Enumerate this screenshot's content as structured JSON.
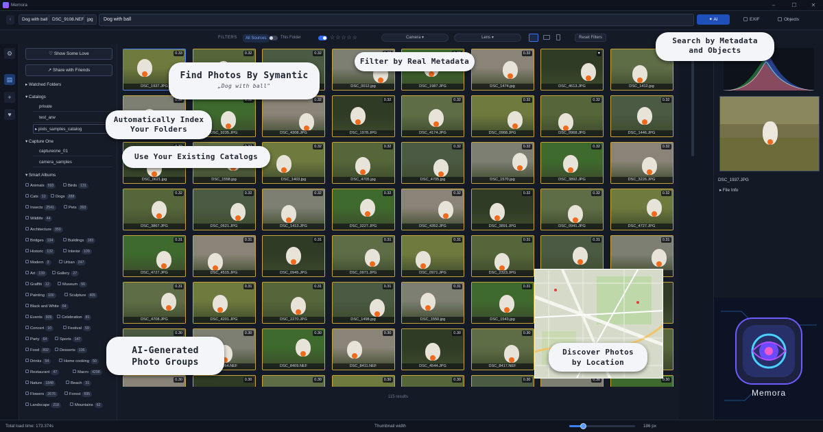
{
  "app": {
    "title": "Memora",
    "logo_text": "Memora"
  },
  "search": {
    "chips": [
      "Dog with ball",
      "DSC_9108.NEF",
      "jpg"
    ],
    "query": "Dog with ball",
    "modes": {
      "ai": "AI",
      "exif": "EXIF",
      "objects": "Objects"
    }
  },
  "filters": {
    "label": "FILTERS",
    "all_sources": "All Sources",
    "this_folder": "This Folder",
    "camera": "Camera",
    "lens": "Lens",
    "reset": "Reset Filters",
    "stars": "☆☆☆☆☆"
  },
  "sidebar": {
    "show_love": "Show Some Love",
    "share": "Share with Friends",
    "watched_folders": "Watched Folders",
    "catalogs_title": "Catalogs",
    "catalogs": [
      "private",
      "test_arw",
      "pixls_samples_catalog"
    ],
    "capture_one_title": "Capture One",
    "capture_one": [
      "captureone_01",
      "camera_samples"
    ],
    "smart_albums_title": "Smart Albums",
    "albums": [
      [
        {
          "name": "Animals",
          "count": "593"
        },
        {
          "name": "Birds",
          "count": "131"
        }
      ],
      [
        {
          "name": "Cats",
          "count": "12"
        },
        {
          "name": "Dogs",
          "count": "288"
        }
      ],
      [
        {
          "name": "Insects",
          "count": "2541"
        },
        {
          "name": "Pets",
          "count": "393"
        }
      ],
      [
        {
          "name": "Wildlife",
          "count": "44"
        }
      ],
      [
        {
          "name": "Architecture",
          "count": "350"
        }
      ],
      [
        {
          "name": "Bridges",
          "count": "134"
        },
        {
          "name": "Buildings",
          "count": "183"
        }
      ],
      [
        {
          "name": "Historic",
          "count": "132"
        },
        {
          "name": "Interior",
          "count": "109"
        }
      ],
      [
        {
          "name": "Modern",
          "count": "3"
        },
        {
          "name": "Urban",
          "count": "247"
        }
      ],
      [
        {
          "name": "Art",
          "count": "139"
        },
        {
          "name": "Gallery",
          "count": "27"
        }
      ],
      [
        {
          "name": "Graffiti",
          "count": "12"
        },
        {
          "name": "Museum",
          "count": "56"
        }
      ],
      [
        {
          "name": "Painting",
          "count": "100"
        },
        {
          "name": "Sculpture",
          "count": "405"
        }
      ],
      [
        {
          "name": "Black and White",
          "count": "64"
        }
      ],
      [
        {
          "name": "Events",
          "count": "609"
        },
        {
          "name": "Celebration",
          "count": "81"
        }
      ],
      [
        {
          "name": "Concert",
          "count": "10"
        },
        {
          "name": "Festival",
          "count": "59"
        }
      ],
      [
        {
          "name": "Party",
          "count": "64"
        },
        {
          "name": "Sports",
          "count": "147"
        }
      ],
      [
        {
          "name": "Food",
          "count": "892"
        },
        {
          "name": "Desserts",
          "count": "136"
        }
      ],
      [
        {
          "name": "Drinks",
          "count": "54"
        },
        {
          "name": "Home cooking",
          "count": "50"
        }
      ],
      [
        {
          "name": "Restaurant",
          "count": "47"
        },
        {
          "name": "Macro",
          "count": "4298"
        }
      ],
      [
        {
          "name": "Nature",
          "count": "1848"
        },
        {
          "name": "Beach",
          "count": "31"
        }
      ],
      [
        {
          "name": "Flowers",
          "count": "2676"
        },
        {
          "name": "Forest",
          "count": "695"
        }
      ],
      [
        {
          "name": "Landscape",
          "count": "218"
        },
        {
          "name": "Mountains",
          "count": "62"
        }
      ]
    ]
  },
  "grid": {
    "rows": [
      [
        {
          "f": "DSC_1937.JPG",
          "s": "0.33"
        },
        {
          "f": "DSC_1937.JPG",
          "s": "0.32"
        },
        {
          "f": "DSC_6979.JPG",
          "s": "0.32"
        },
        {
          "f": "DSC_0012.jpg",
          "s": "0.32"
        },
        {
          "f": "DSC_1987.JPG",
          "s": "0.32"
        },
        {
          "f": "DSC_1474.jpg",
          "s": "0.32"
        },
        {
          "f": "DSC_4613.JPG",
          "s": "♥"
        },
        {
          "f": "DSC_1412.jpg",
          "s": "0.32"
        }
      ],
      [
        {
          "f": "DSC_1937.JPG",
          "s": "0.32"
        },
        {
          "f": "DSC_9235.JPG",
          "s": "0.32"
        },
        {
          "f": "DSC_4308.JPG",
          "s": "0.32"
        },
        {
          "f": "DSC_1978.JPG",
          "s": "0.32"
        },
        {
          "f": "DSC_4174.JPG",
          "s": "0.32"
        },
        {
          "f": "DSC_0968.JPG",
          "s": "0.32"
        },
        {
          "f": "DSC_0968.JPG",
          "s": "0.32"
        },
        {
          "f": "DSC_1446.JPG",
          "s": "0.32"
        }
      ],
      [
        {
          "f": "DSC_0621.jpg",
          "s": "0.32"
        },
        {
          "f": "DSC_1558.jpg",
          "s": "0.32"
        },
        {
          "f": "DSC_1403.jpg",
          "s": "0.32"
        },
        {
          "f": "DSC_4705.jpg",
          "s": "0.32"
        },
        {
          "f": "DSC_4705.jpg",
          "s": "0.32"
        },
        {
          "f": "DSC_1570.jpg",
          "s": "0.32"
        },
        {
          "f": "DSC_3892.JPG",
          "s": "0.32"
        },
        {
          "f": "DSC_3226.JPG",
          "s": "0.32"
        }
      ],
      [
        {
          "f": "DSC_3867.JPG",
          "s": "0.32"
        },
        {
          "f": "DSC_0621.JPG",
          "s": "0.32"
        },
        {
          "f": "DSC_1413.JPG",
          "s": "0.32"
        },
        {
          "f": "DSC_3227.JPG",
          "s": "0.32"
        },
        {
          "f": "DSC_4352.JPG",
          "s": "0.32"
        },
        {
          "f": "DSC_3891.JPG",
          "s": "0.32"
        },
        {
          "f": "DSC_0941.JPG",
          "s": "0.32"
        },
        {
          "f": "DSC_4727.JPG",
          "s": "0.32"
        }
      ],
      [
        {
          "f": "DSC_4727.JPG",
          "s": "0.31"
        },
        {
          "f": "DSC_4515.JPG",
          "s": "0.31"
        },
        {
          "f": "DSC_0945.JPG",
          "s": "0.31"
        },
        {
          "f": "DSC_0971.JPG",
          "s": "0.31"
        },
        {
          "f": "DSC_0971.JPG",
          "s": "0.31"
        },
        {
          "f": "DSC_2323.JPG",
          "s": "0.31"
        },
        {
          "f": "DSC_0971.JPG",
          "s": "0.31"
        },
        {
          "f": "DSC_4617.JPG",
          "s": "0.31"
        }
      ],
      [
        {
          "f": "DSC_4708.JPG",
          "s": "0.31"
        },
        {
          "f": "DSC_4201.JPG",
          "s": "0.31"
        },
        {
          "f": "DSC_2270.JPG",
          "s": "0.31"
        },
        {
          "f": "DSC_1498.jpg",
          "s": "0.31"
        },
        {
          "f": "DSC_1550.jpg",
          "s": "0.31"
        },
        {
          "f": "DSC_1543.jpg",
          "s": "0.31"
        },
        {
          "f": "",
          "s": ""
        },
        {
          "f": "",
          "s": ""
        }
      ],
      [
        {
          "f": "DSC_1164.NEF",
          "s": "0.30"
        },
        {
          "f": "DSC_1164.NEF",
          "s": "0.30"
        },
        {
          "f": "DSC_8409.NEF",
          "s": "0.30"
        },
        {
          "f": "DSC_8411.NEF",
          "s": "0.30"
        },
        {
          "f": "DSC_4544.JPG",
          "s": "0.30"
        },
        {
          "f": "DSC_8417.NEF",
          "s": "0.30"
        },
        {
          "f": "",
          "s": ""
        },
        {
          "f": "",
          "s": ""
        }
      ],
      [
        {
          "f": "",
          "s": "0.30"
        },
        {
          "f": "",
          "s": "0.30"
        },
        {
          "f": "",
          "s": "0.30"
        },
        {
          "f": "",
          "s": "0.30"
        },
        {
          "f": "",
          "s": "0.30"
        },
        {
          "f": "",
          "s": "0.30"
        },
        {
          "f": "",
          "s": "0.30"
        },
        {
          "f": "",
          "s": "0.30"
        }
      ]
    ],
    "results": "115 results"
  },
  "callouts": {
    "semantic_title": "Find Photos By Symantic",
    "semantic_sub": "„Dog with ball\"",
    "metadata_filter": "Filter by Real Metadata",
    "search_meta": [
      "Search by Metadata",
      "and Objects"
    ],
    "index": [
      "Automatically Index",
      "Your Folders"
    ],
    "catalogs": "Use Your Existing Catalogs",
    "ai_groups": [
      "AI-Generated",
      "Photo Groups"
    ],
    "location": [
      "Discover Photos",
      "by Location"
    ]
  },
  "preview": {
    "filename": "DSC_1937.JPG",
    "file_info": "File Info"
  },
  "status": {
    "load_time": "Total load time: 173.374s",
    "thumb_label": "Thumbnail width",
    "thumb_px": "186 px",
    "thumb_fraction": 0.6
  }
}
